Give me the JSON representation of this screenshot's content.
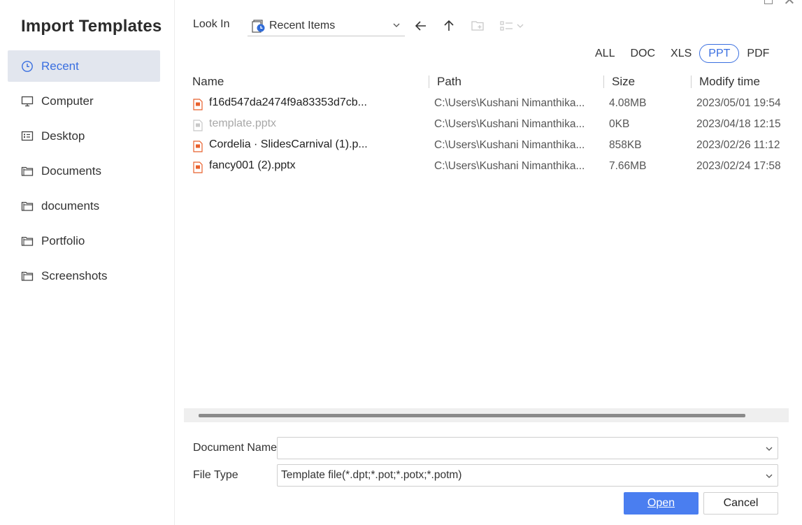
{
  "dialog": {
    "title": "Import Templates"
  },
  "sidebar": {
    "items": [
      {
        "label": "Recent",
        "icon": "clock-icon",
        "active": true
      },
      {
        "label": "Computer",
        "icon": "monitor-icon"
      },
      {
        "label": "Desktop",
        "icon": "desktop-icon"
      },
      {
        "label": "Documents",
        "icon": "folder-icon"
      },
      {
        "label": "documents",
        "icon": "folder-icon"
      },
      {
        "label": "Portfolio",
        "icon": "folder-icon"
      },
      {
        "label": "Screenshots",
        "icon": "folder-icon"
      }
    ]
  },
  "toolbar": {
    "look_in_label": "Look In",
    "look_in_value": "Recent Items"
  },
  "filters": [
    "ALL",
    "DOC",
    "XLS",
    "PPT",
    "PDF"
  ],
  "active_filter": "PPT",
  "table": {
    "headers": {
      "name": "Name",
      "path": "Path",
      "size": "Size",
      "time": "Modify time"
    },
    "rows": [
      {
        "name": "f16d547da2474f9a83353d7cb...",
        "path": "C:\\Users\\Kushani Nimanthika...",
        "size": "4.08MB",
        "time": "2023/05/01 19:54",
        "dim": false
      },
      {
        "name": "template.pptx",
        "path": "C:\\Users\\Kushani Nimanthika...",
        "size": "0KB",
        "time": "2023/04/18 12:15",
        "dim": true
      },
      {
        "name": "Cordelia · SlidesCarnival (1).p...",
        "path": "C:\\Users\\Kushani Nimanthika...",
        "size": "858KB",
        "time": "2023/02/26 11:12",
        "dim": false
      },
      {
        "name": "fancy001 (2).pptx",
        "path": "C:\\Users\\Kushani Nimanthika...",
        "size": "7.66MB",
        "time": "2023/02/24 17:58",
        "dim": false
      }
    ]
  },
  "form": {
    "doc_name_label": "Document Name",
    "doc_name_value": "",
    "file_type_label": "File Type",
    "file_type_value": "Template file(*.dpt;*.pot;*.potx;*.potm)"
  },
  "buttons": {
    "open": "Open",
    "cancel": "Cancel"
  },
  "colors": {
    "accent": "#3a6fe0",
    "primary_button": "#4a7ef0",
    "active_nav_bg": "#e2e6ee",
    "ppt_icon": "#e8602c"
  }
}
